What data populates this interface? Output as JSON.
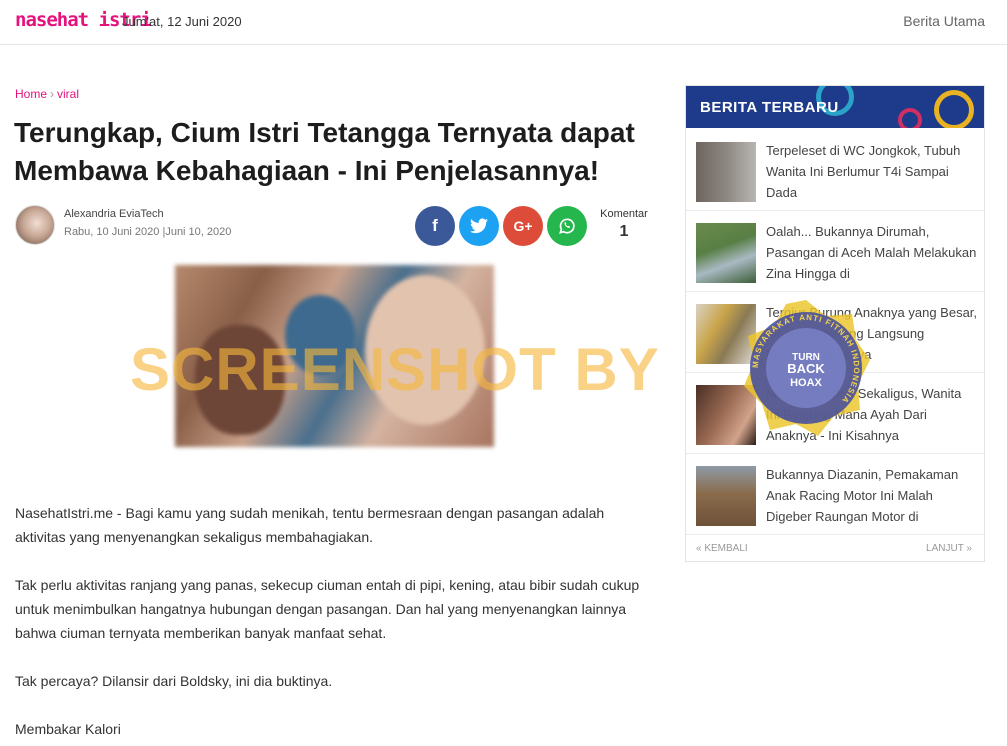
{
  "header": {
    "logo": "nasehat istri",
    "date": "Jum'at, 12 Juni 2020",
    "nav_item": "Berita Utama"
  },
  "breadcrumb": {
    "home": "Home",
    "separator": "›",
    "category": "viral"
  },
  "article": {
    "title": "Terungkap, Cium Istri Tetangga Ternyata dapat Membawa Kebahagiaan - Ini Penjelasannya!",
    "author": "Alexandria EviaTech",
    "date": "Rabu, 10 Juni 2020 |Juni 10, 2020",
    "comment_label": "Komentar",
    "comment_count": "1",
    "watermark": "SCREENSHOT BY",
    "paragraphs": [
      "NasehatIstri.me - Bagi kamu yang sudah menikah, tentu bermesraan dengan pasangan adalah aktivitas yang menyenangkan sekaligus membahagiakan.",
      "Tak perlu aktivitas ranjang yang panas, sekecup ciuman entah di pipi, kening, atau bibir sudah cukup untuk menimbulkan hangatnya hubungan dengan pasangan. Dan hal yang menyenangkan lainnya bahwa ciuman ternyata memberikan banyak manfaat sehat.",
      "Tak percaya? Dilansir dari Boldsky, ini dia buktinya.",
      "Membakar Kalori"
    ]
  },
  "share": {
    "facebook_icon": "f",
    "twitter_icon": "🐦",
    "gplus_icon": "G+",
    "whatsapp_icon": "✆"
  },
  "sidebar": {
    "title": "BERITA TERBARU",
    "items": [
      {
        "text": "Terpeleset di WC Jongkok, Tubuh Wanita Ini Berlumur T4i Sampai Dada"
      },
      {
        "text": "Oalah... Bukannya Dirumah, Pasangan di Aceh Malah Melakukan Zina Hingga di"
      },
      {
        "text": "Tergiur Burung Anaknya yang Besar, Mbah Gembreng Langsung Menikahi Anaknya"
      },
      {
        "text": "Menikahi 5 pria Sekaligus, Wanita Ini Bingung Mana Ayah Dari Anaknya - Ini Kisahnya"
      },
      {
        "text": "Bukannya Diazanin, Pemakaman Anak Racing Motor Ini Malah Digeber Raungan Motor di"
      }
    ],
    "prev": "« KEMBALI",
    "next": "LANJUT »"
  },
  "stamp": {
    "line1": "TURN",
    "line2": "BACK",
    "line3": "HOAX",
    "ring": "MASYARAKAT ANTI FITNAH INDONESIA"
  },
  "colors": {
    "accent": "#e5127d",
    "sidebar_header": "#1e3a8a",
    "watermark": "#f6b73c"
  }
}
